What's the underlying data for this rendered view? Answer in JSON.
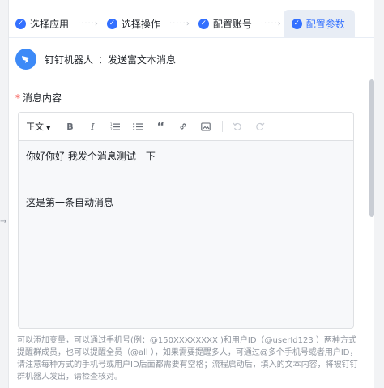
{
  "steps": [
    {
      "label": "选择应用",
      "state": "done"
    },
    {
      "label": "选择操作",
      "state": "done"
    },
    {
      "label": "配置账号",
      "state": "done"
    },
    {
      "label": "配置参数",
      "state": "active"
    }
  ],
  "app": {
    "name": "钉钉机器人",
    "action": "：发送富文本消息"
  },
  "field": {
    "required_mark": "*",
    "label": "消息内容"
  },
  "toolbar": {
    "heading": "正文",
    "bold": "B",
    "italic": "I",
    "ordered_list_icon": "ordered-list-icon",
    "bullet_list_icon": "bullet-list-icon",
    "quote": "“",
    "link_icon": "link-icon",
    "image_icon": "image-icon",
    "undo_icon": "undo-icon",
    "redo_icon": "redo-icon"
  },
  "editor_content": {
    "line1": "你好你好  我发个消息测试一下",
    "line2": "",
    "line3": "这是第一条自动消息"
  },
  "hint": "可以添加变量，可以通过手机号(例：@150XXXXXXXX )和用户ID（@userId123 ）两种方式提醒群成员，也可以提醒全员（@all ），如果需要提醒多人，可通过@多个手机号或者用户ID，请注意每种方式的手机号或用户ID后面都需要有空格；流程启动后，填入的文本内容，将被钉钉群机器人发出，请检查核对。",
  "colors": {
    "accent": "#3370ff",
    "app_icon": "#3d8af7",
    "required": "#f54a45"
  }
}
